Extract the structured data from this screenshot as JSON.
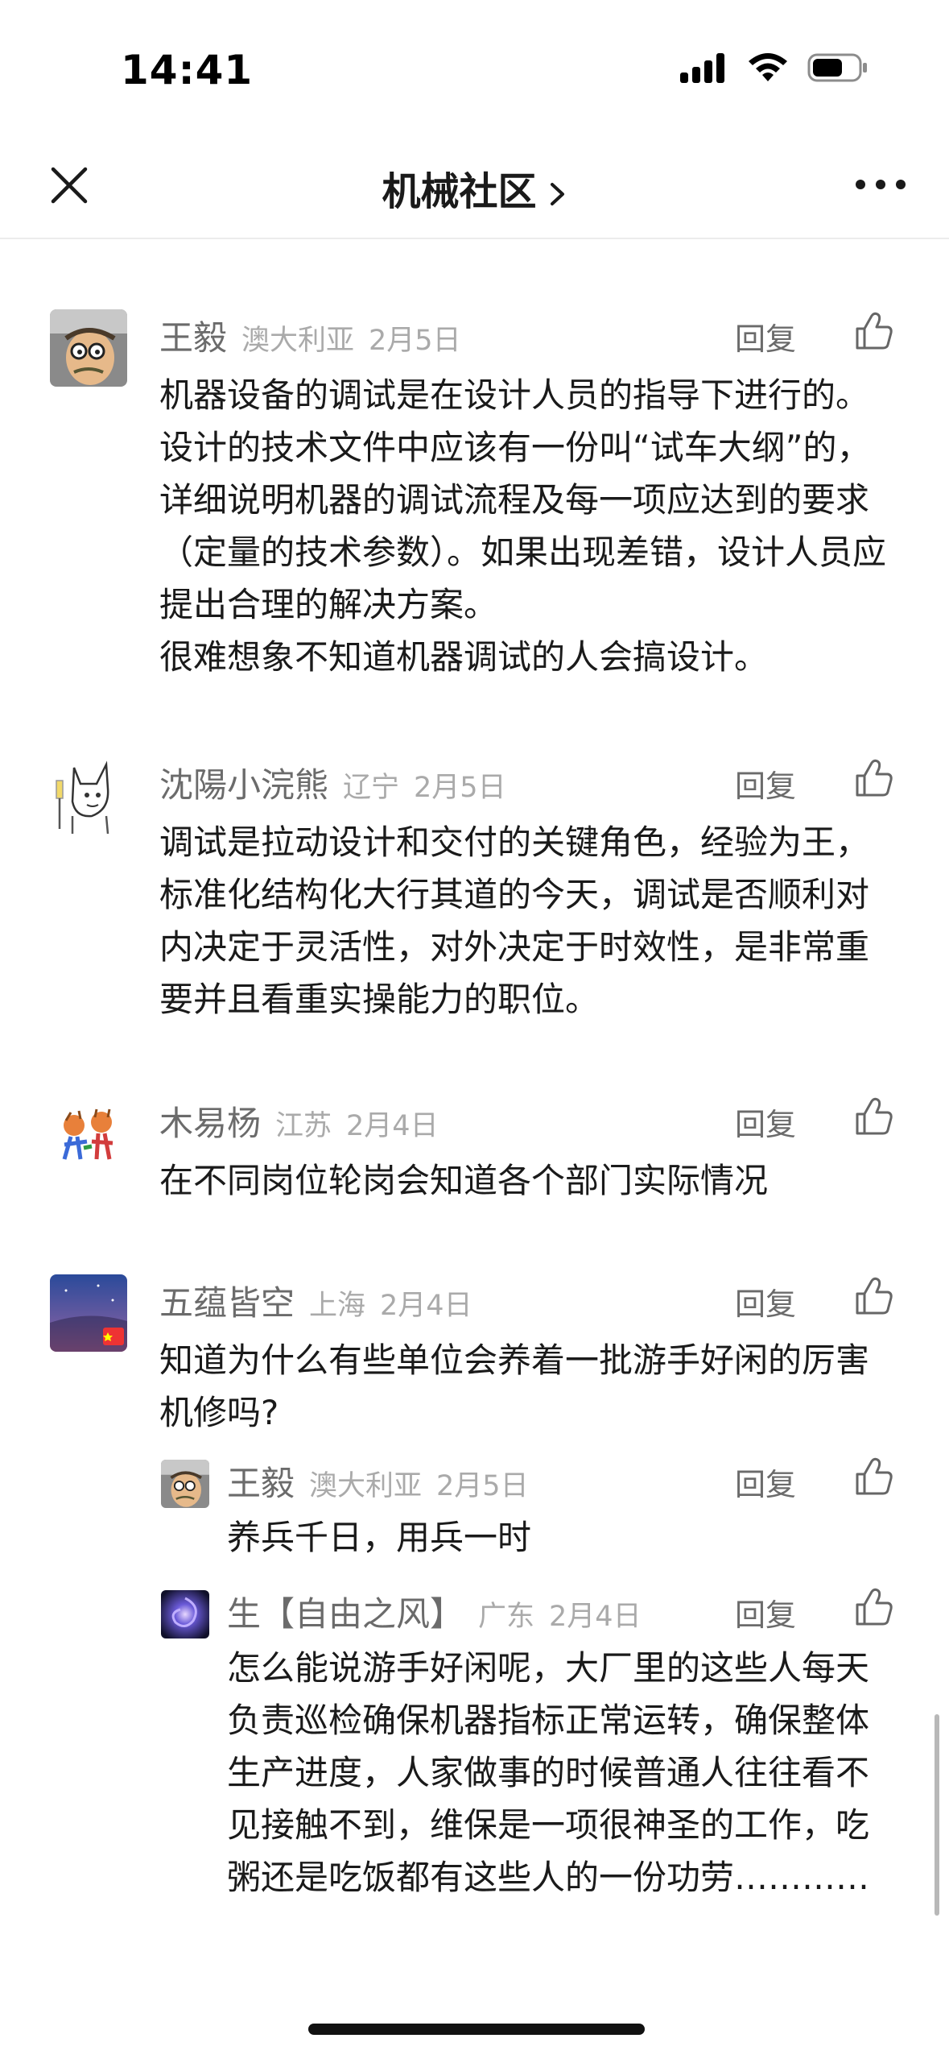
{
  "status": {
    "time": "14:41"
  },
  "nav": {
    "title": "机械社区"
  },
  "comments": [
    {
      "name": "王毅",
      "location": "澳大利亚",
      "date": "2月5日",
      "reply": "回复",
      "lines": [
        "机器设备的调试是在设计人员的指导下进行的。设计的技术文件中应该有一份叫“试车大纲”的，详细说明机器的调试流程及每一项应达到的要求（定量的技术参数）。如果出现差错，设计人员应提出合理的解决方案。",
        "很难想象不知道机器调试的人会搞设计。"
      ]
    },
    {
      "name": "沈陽小浣熊",
      "location": "辽宁",
      "date": "2月5日",
      "reply": "回复",
      "lines": [
        "调试是拉动设计和交付的关键角色，经验为王，标准化结构化大行其道的今天，调试是否顺利对内决定于灵活性，对外决定于时效性，是非常重要并且看重实操能力的职位。"
      ]
    },
    {
      "name": "木易杨",
      "location": "江苏",
      "date": "2月4日",
      "reply": "回复",
      "lines": [
        "在不同岗位轮岗会知道各个部门实际情况"
      ]
    },
    {
      "name": "五蕴皆空",
      "location": "上海",
      "date": "2月4日",
      "reply": "回复",
      "lines": [
        "知道为什么有些单位会养着一批游手好闲的厉害机修吗?"
      ],
      "replies": [
        {
          "name": "王毅",
          "location": "澳大利亚",
          "date": "2月5日",
          "reply": "回复",
          "lines": [
            "养兵千日，用兵一时"
          ]
        },
        {
          "name": "生【自由之风】",
          "location": "广东",
          "date": "2月4日",
          "reply": "回复",
          "lines": [
            "怎么能说游手好闲呢，大厂里的这些人每天负责巡检确保机器指标正常运转，确保整体生产进度，人家做事的时候普通人往往看不见接触不到，维保是一项很神圣的工作，吃粥还是吃饭都有这些人的一份功劳…………"
          ]
        }
      ]
    }
  ],
  "icons": {
    "close": "close-icon",
    "chevron": "chevron-right-icon",
    "more": "more-icon",
    "like": "thumbs-up-icon"
  },
  "colors": {
    "accent": "#1a1a1a",
    "meta": "#aaaaaa",
    "name": "#6b6b6b"
  }
}
